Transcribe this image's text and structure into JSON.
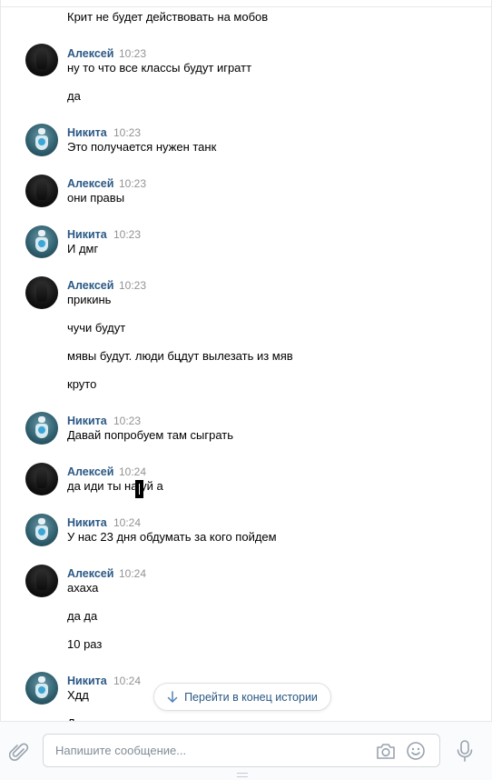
{
  "messages_top": {
    "first_line": "Крит не будет действовать на мобов"
  },
  "groups": [
    {
      "author": "Алексей",
      "time": "10:23",
      "lines": [
        "ну то что все классы будут игратт",
        "да"
      ]
    },
    {
      "author": "Никита",
      "time": "10:23",
      "lines": [
        "Это получается нужен танк"
      ]
    },
    {
      "author": "Алексей",
      "time": "10:23",
      "lines": [
        "они правы"
      ]
    },
    {
      "author": "Никита",
      "time": "10:23",
      "lines": [
        "И дмг"
      ]
    },
    {
      "author": "Алексей",
      "time": "10:23",
      "lines": [
        "прикинь",
        "чучи будут",
        "мявы будут. люди бцдут вылезать из мяв",
        "круто"
      ]
    },
    {
      "author": "Никита",
      "time": "10:23",
      "lines": [
        "Давай попробуем там сыграть"
      ]
    },
    {
      "author": "Алексей",
      "time": "10:24",
      "lines": [
        "да иди ты на уй а"
      ]
    },
    {
      "author": "Никита",
      "time": "10:24",
      "lines": [
        "У нас 23 дня обдумать за кого пойдем"
      ]
    },
    {
      "author": "Алексей",
      "time": "10:24",
      "lines": [
        "ахаха",
        "да да",
        "10 раз"
      ]
    },
    {
      "author": "Никита",
      "time": "10:24",
      "lines": [
        "Хдд",
        "Д"
      ]
    }
  ],
  "jump_button": {
    "label": "Перейти в конец истории"
  },
  "composer": {
    "placeholder": "Напишите сообщение..."
  },
  "colors": {
    "author": "#2a5885",
    "time": "#939393",
    "placeholder": "#818c99",
    "icons": "#99a2ad"
  }
}
